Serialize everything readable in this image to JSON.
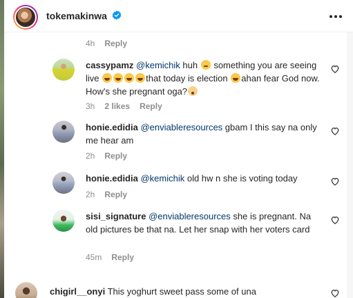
{
  "header": {
    "username": "tokemakinwa",
    "verified_icon": "verified-badge-icon",
    "more_icon": "more-horizontal-icon"
  },
  "top_meta": {
    "time": "4h",
    "reply": "Reply"
  },
  "comments": [
    {
      "username": "cassypamz",
      "mention": "@kemichik",
      "text_1": " huh ",
      "text_2": " something you are seeing live ",
      "text_3": "that today is election ",
      "text_4": "ahan fear God now. How's she pregnant oga?",
      "time": "3h",
      "likes": "2 likes",
      "reply": "Reply"
    },
    {
      "username": "honie.edidia",
      "mention": "@enviableresources",
      "text": " gbam I this say na only me hear am",
      "time": "2h",
      "reply": "Reply"
    },
    {
      "username": "honie.edidia",
      "mention": "@kemichik",
      "text": " old hw n she is voting today",
      "time": "2h",
      "reply": "Reply"
    },
    {
      "username": "sisi_signature",
      "mention": "@enviableresources",
      "text": " she is pregnant. Na old pictures be that na. Let her snap with her voters card",
      "time": "45m",
      "reply": "Reply"
    },
    {
      "username": "chigirl__onyi",
      "text": "This yoghurt sweet pass some of una"
    }
  ],
  "colors": {
    "mention": "#00376b",
    "muted": "#8e8e8e",
    "text": "#262626",
    "verified": "#0095f6"
  }
}
